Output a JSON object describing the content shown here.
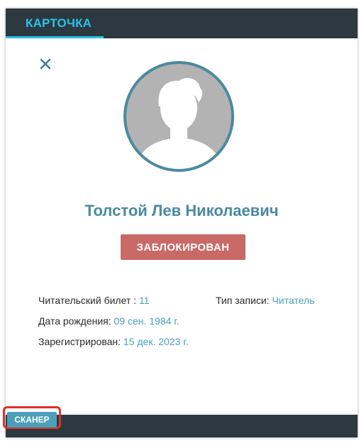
{
  "header": {
    "tab_label": "КАРТОЧКА"
  },
  "card": {
    "full_name": "Толстой Лев Николаевич",
    "status": "ЗАБЛОКИРОВАН",
    "ticket_label": "Читательский билет : ",
    "ticket_value": "11",
    "record_type_label": "Тип записи: ",
    "record_type_value": "Читатель",
    "birth_label": "Дата рождения: ",
    "birth_value": "09 сен. 1984 г.",
    "registered_label": "Зарегистрирован: ",
    "registered_value": "15 дек. 2023 г."
  },
  "footer": {
    "scanner_label": "СКАНЕР"
  },
  "colors": {
    "header_bg": "#2c3940",
    "accent": "#29c3e8",
    "name_color": "#4a8aa0",
    "blocked_badge": "#c96a66",
    "value_link": "#4aa0c0",
    "highlight": "#e0302a"
  },
  "icons": {
    "close": "close-icon",
    "avatar": "user-silhouette-icon"
  }
}
